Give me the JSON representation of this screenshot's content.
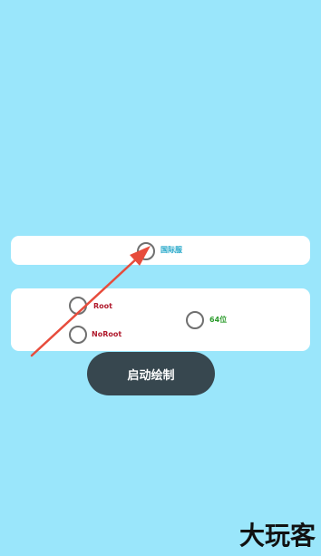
{
  "server_options": {
    "international_label": "国际服"
  },
  "mode_options": {
    "root_label": "Root",
    "noroot_label": "NoRoot",
    "arch_64_label": "64位"
  },
  "actions": {
    "start_draw_label": "启动绘制"
  },
  "watermark": {
    "text": "大玩客"
  },
  "colors": {
    "background": "#9ae6fb",
    "card": "#ffffff",
    "button": "#37474f",
    "annotation_arrow": "#e74c3c",
    "international_label": "#22a6c8",
    "root_label": "#b0192c",
    "arch_label": "#2d9c2d"
  }
}
